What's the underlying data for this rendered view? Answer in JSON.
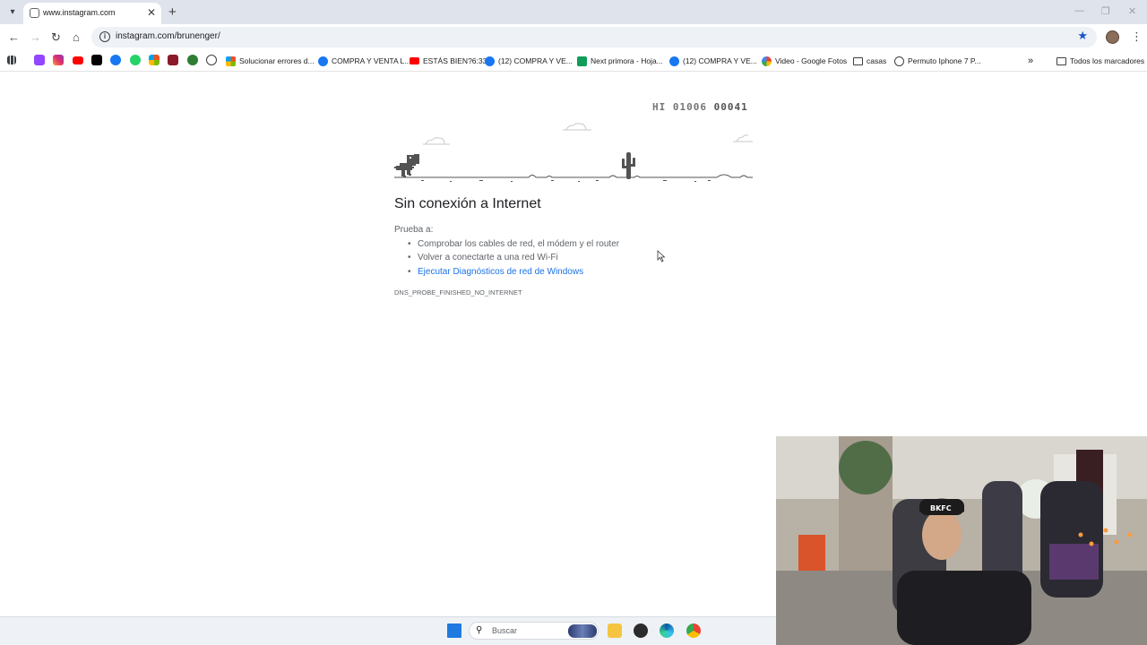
{
  "tab": {
    "title": "www.instagram.com",
    "close": "✕"
  },
  "new_tab": "+",
  "window_controls": {
    "minimize": "—",
    "restore": "❐",
    "close": "✕"
  },
  "toolbar": {
    "back": "←",
    "forward": "→",
    "reload": "↻",
    "home": "⌂",
    "info": "i",
    "star": "★",
    "menu": "⋮"
  },
  "address": {
    "url": "instagram.com/brunenger/"
  },
  "bookmarks": {
    "items": [
      {
        "label": "Solucionar errores d...",
        "icon": "microsoft-icon"
      },
      {
        "label": "COMPRA Y VENTA L...",
        "icon": "facebook-icon"
      },
      {
        "label": "ESTÁS BIEN?6:33",
        "icon": "youtube-icon"
      },
      {
        "label": "(12) COMPRA Y VE...",
        "icon": "facebook-icon"
      },
      {
        "label": "Next primora - Hoja...",
        "icon": "sheets-icon"
      },
      {
        "label": "(12) COMPRA Y VE...",
        "icon": "facebook-icon"
      },
      {
        "label": "Video - Google Fotos",
        "icon": "photos-icon"
      },
      {
        "label": "casas",
        "icon": "folder-icon"
      },
      {
        "label": "Permuto Iphone 7 P...",
        "icon": "globe-icon"
      }
    ],
    "overflow": "»",
    "all_bookmarks": "Todos los marcadores"
  },
  "dino_game": {
    "hi_label": "HI",
    "hi_score": "01006",
    "score": "00041"
  },
  "error_page": {
    "heading": "Sin conexión a Internet",
    "try_label": "Prueba a:",
    "suggestions": [
      "Comprobar los cables de red, el módem y el router",
      "Volver a conectarte a una red Wi-Fi",
      "Ejecutar Diagnósticos de red de Windows"
    ],
    "error_code": "DNS_PROBE_FINISHED_NO_INTERNET"
  },
  "taskbar": {
    "search_placeholder": "Buscar"
  },
  "colors": {
    "accent": "#1a73e8",
    "tabstrip": "#dfe3eb",
    "dino": "#535353"
  }
}
